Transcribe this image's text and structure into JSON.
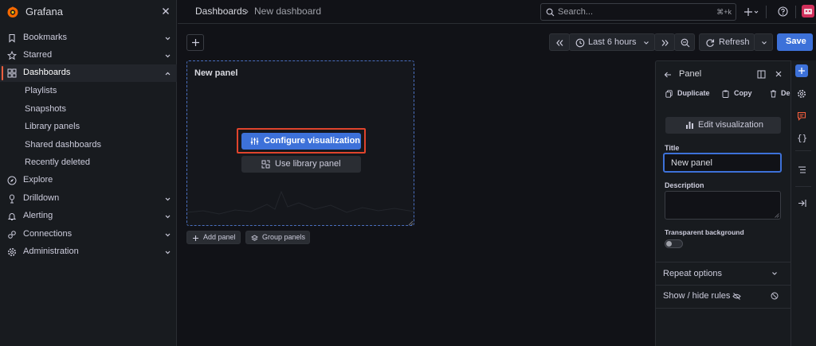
{
  "app": {
    "name": "Grafana",
    "logo_color": "#f46800"
  },
  "sidebar": {
    "items": [
      {
        "label": "Bookmarks",
        "icon": "bookmark-icon"
      },
      {
        "label": "Starred",
        "icon": "star-icon"
      },
      {
        "label": "Dashboards",
        "icon": "dashboards-icon",
        "active": true
      },
      {
        "label": "Explore",
        "icon": "compass-icon"
      },
      {
        "label": "Drilldown",
        "icon": "drilldown-icon"
      },
      {
        "label": "Alerting",
        "icon": "bell-icon"
      },
      {
        "label": "Connections",
        "icon": "connections-icon"
      },
      {
        "label": "Administration",
        "icon": "gear-icon"
      }
    ],
    "subitems": [
      {
        "label": "Playlists"
      },
      {
        "label": "Snapshots"
      },
      {
        "label": "Library panels"
      },
      {
        "label": "Shared dashboards"
      },
      {
        "label": "Recently deleted"
      }
    ]
  },
  "header": {
    "breadcrumb": [
      "Dashboards",
      "New dashboard"
    ],
    "search_placeholder": "Search...",
    "search_shortcut": "⌘+k"
  },
  "toolbar": {
    "time_range": "Last 6 hours",
    "refresh_label": "Refresh",
    "save_label": "Save"
  },
  "panel": {
    "title": "New panel",
    "configure_label": "Configure visualization",
    "library_label": "Use library panel"
  },
  "add_bar": {
    "add_panel_label": "Add panel",
    "group_panels_label": "Group panels"
  },
  "edit_pane": {
    "heading": "Panel",
    "duplicate_label": "Duplicate",
    "copy_label": "Copy",
    "delete_label": "De",
    "edit_vis_label": "Edit visualization",
    "title_label": "Title",
    "title_value": "New panel",
    "description_label": "Description",
    "description_value": "",
    "transparent_label": "Transparent background",
    "transparent_on": false,
    "repeat_label": "Repeat options",
    "showhide_label": "Show / hide rules"
  },
  "colors": {
    "accent": "#3d71d9",
    "highlight": "#e0442c",
    "active_marker": "#f55f3e"
  }
}
